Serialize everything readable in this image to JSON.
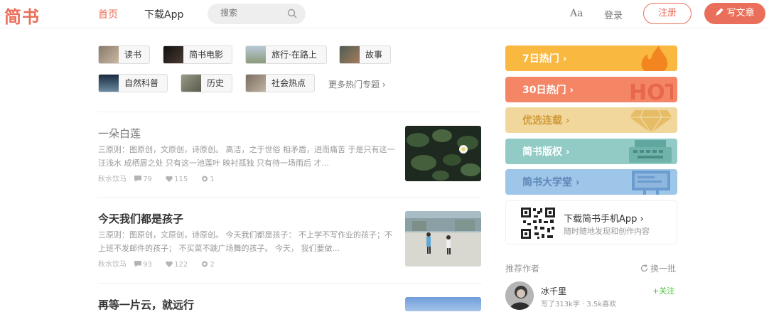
{
  "header": {
    "logo": "简书",
    "nav_home": "首页",
    "nav_download": "下载App",
    "search_placeholder": "搜索",
    "font_toggle": "Aa",
    "login": "登录",
    "register": "注册",
    "write": "写文章"
  },
  "topics": [
    {
      "label": "读书"
    },
    {
      "label": "简书电影"
    },
    {
      "label": "旅行·在路上"
    },
    {
      "label": "故事"
    },
    {
      "label": "自然科普"
    },
    {
      "label": "历史"
    },
    {
      "label": "社会热点"
    }
  ],
  "more_topics": "更多热门专题 ›",
  "articles": [
    {
      "title": "一朵白莲",
      "abstract": "三原则：图原创，文原创，诗原创。 高洁，之于世俗 相矛盾，进而痛苦 于是只有这一汪浅水 成栖居之处 只有这一池莲叶 映衬孤独 只有待一场雨后 才...",
      "author": "秋水饮马",
      "comments": "79",
      "likes": "115",
      "rewards": "1"
    },
    {
      "title": "今天我们都是孩子",
      "abstract": "三原则：图原创，文原创，诗原创。 今天我们都是孩子： 不上学不写作业的孩子；不上班不发邮件的孩子； 不买菜不跳广场舞的孩子。 今天， 我们要做...",
      "author": "秋水饮马",
      "comments": "93",
      "likes": "122",
      "rewards": "2"
    },
    {
      "title": "再等一片云，就远行"
    }
  ],
  "boards": [
    {
      "label": "7日热门 ›",
      "color": "#f9b83f"
    },
    {
      "label": "30日热门 ›",
      "color": "#f48565"
    },
    {
      "label": "优选连载 ›",
      "color": "#f1d79c"
    },
    {
      "label": "简书版权 ›",
      "color": "#92cbc5"
    },
    {
      "label": "简书大学堂 ›",
      "color": "#9ec6e8"
    }
  ],
  "download": {
    "title": "下载简书手机App ›",
    "subtitle": "随时随地发现和创作内容"
  },
  "recommend": {
    "title": "推荐作者",
    "refresh": "换一批",
    "authors": [
      {
        "name": "冰千里",
        "info": "写了313k字 · 3.5k喜欢",
        "follow": "+关注"
      }
    ]
  },
  "colors": {
    "brand": "#ea6f5a",
    "follow_green": "#42c02e"
  }
}
